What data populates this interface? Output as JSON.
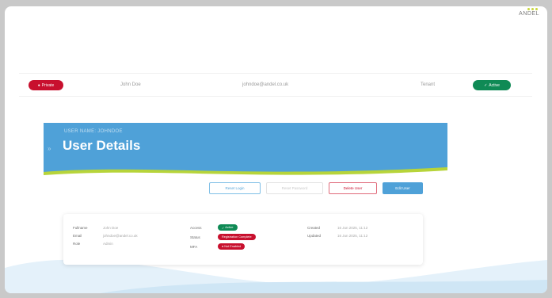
{
  "brand": {
    "name": "ANDEL"
  },
  "user_bar": {
    "left_button": "Private",
    "name": "John Doe",
    "email": "johndoe@andel.co.uk",
    "tenant": "Tenant",
    "right_button": "Active"
  },
  "banner": {
    "subtitle": "USER NAME: JOHNDOE",
    "title": "User Details"
  },
  "actions": {
    "reset_label": "Reset Login",
    "reset_password_label": "Reset Password",
    "delete_label": "Delete User",
    "edit_label": "Edit User"
  },
  "details": {
    "col1": [
      {
        "label": "Fullname",
        "value": "John Doe"
      },
      {
        "label": "Email",
        "value": "johndoe@andel.co.uk"
      },
      {
        "label": "Role",
        "value": "Admin"
      }
    ],
    "col2": [
      {
        "label": "Access",
        "value": "Active"
      },
      {
        "label": "Status",
        "value": "Registration Complete"
      },
      {
        "label": "MFA",
        "value": "Not Enabled"
      }
    ],
    "col3": [
      {
        "label": "Created",
        "value": "16 Jun 2025, 11:12"
      },
      {
        "label": "Updated",
        "value": "16 Jun 2025, 11:12"
      }
    ]
  },
  "colors": {
    "accent_blue": "#4fa1d8",
    "danger_red": "#c8102e",
    "success_green": "#0f8a55",
    "accent_lime": "#b7d43a"
  }
}
